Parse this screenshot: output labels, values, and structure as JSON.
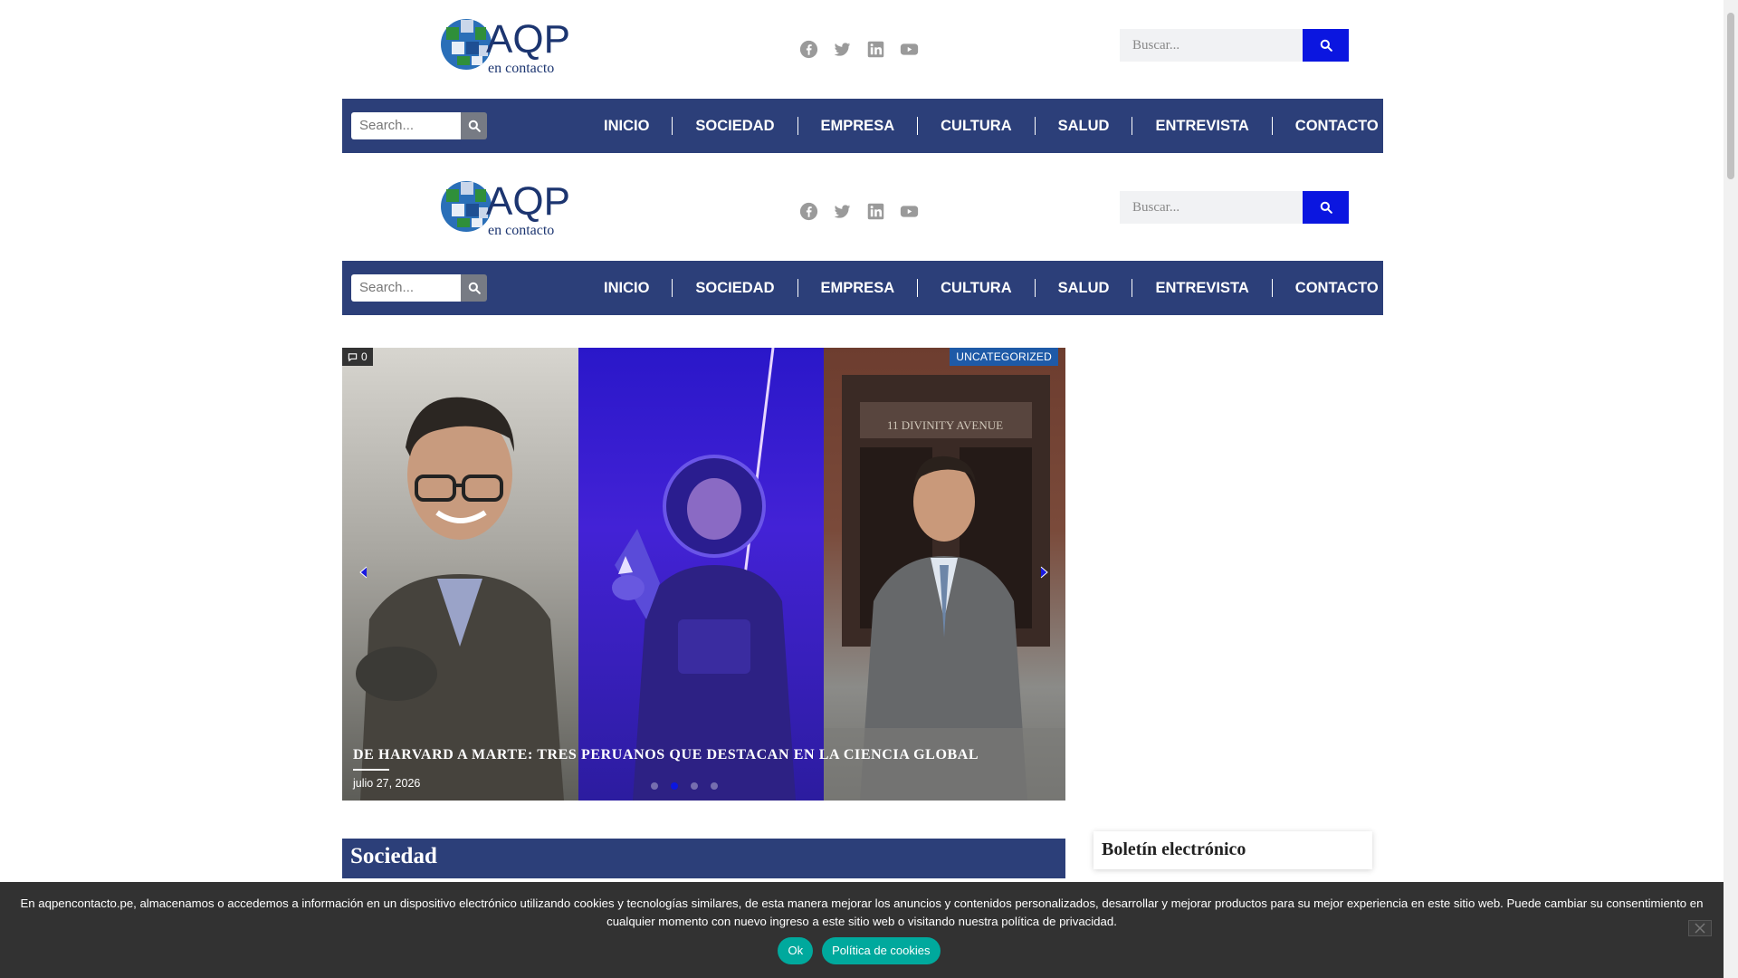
{
  "logo": {
    "brand": "AQP",
    "tagline": "en contacto"
  },
  "social": [
    {
      "name": "facebook-icon"
    },
    {
      "name": "twitter-icon"
    },
    {
      "name": "linkedin-icon"
    },
    {
      "name": "youtube-icon"
    }
  ],
  "top_search": {
    "placeholder": "Buscar..."
  },
  "nav_search": {
    "placeholder": "Search..."
  },
  "menu": [
    "INICIO",
    "SOCIEDAD",
    "EMPRESA",
    "CULTURA",
    "SALUD",
    "ENTREVISTA",
    "CONTACTO"
  ],
  "slider": {
    "comments": "0",
    "category": "UNCATEGORIZED",
    "title": "De Harvard a Marte: tres peruanos que destacan en la ciencia global",
    "date": "julio 27, 2026",
    "slide_count": 4,
    "active_slide": 1
  },
  "section": {
    "title": "Sociedad"
  },
  "widget": {
    "title": "Boletín electrónico"
  },
  "cookie": {
    "text": "En aqpencontacto.pe, almacenamos o accedemos a información en un dispositivo electrónico utilizando cookies y tecnologías similares, de esta manera mejorar los anuncios y contenidos personalizados, desarrollar y mejorar productos para su mejor experiencia en este sitio web. Puede cambiar su consentimiento en cualquier momento con nuevo ingreso a este sitio web o visitando nuestra política de privacidad.",
    "ok_label": "Ok",
    "policy_label": "Política de cookies"
  },
  "colors": {
    "nav_bg": "#2c3f79",
    "search_button": "#0b16e0",
    "cookie_bg": "#323232",
    "cookie_button": "#00a99d",
    "category_badge": "#1e5aa7"
  }
}
